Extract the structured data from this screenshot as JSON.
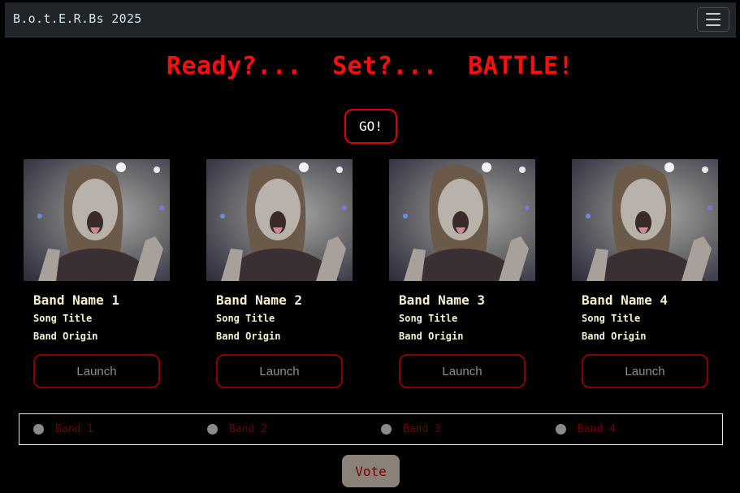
{
  "navbar": {
    "brand": "B.o.t.E.R.Bs 2025",
    "menu_icon": "hamburger-menu-icon"
  },
  "headline": "Ready?...  Set?...  BATTLE!",
  "go_button": "GO!",
  "bands": [
    {
      "name": "Band Name 1",
      "song": "Song Title",
      "origin": "Band Origin",
      "launch": "Launch"
    },
    {
      "name": "Band Name 2",
      "song": "Song Title",
      "origin": "Band Origin",
      "launch": "Launch"
    },
    {
      "name": "Band Name 3",
      "song": "Song Title",
      "origin": "Band Origin",
      "launch": "Launch"
    },
    {
      "name": "Band Name 4",
      "song": "Song Title",
      "origin": "Band Origin",
      "launch": "Launch"
    }
  ],
  "vote_options": [
    "Band 1",
    "Band 2",
    "Band 3",
    "Band 4"
  ],
  "vote_button": "Vote",
  "colors": {
    "accent": "#ff0d0d",
    "navbar_bg": "#212529",
    "vote_button_bg": "#8a8178"
  }
}
